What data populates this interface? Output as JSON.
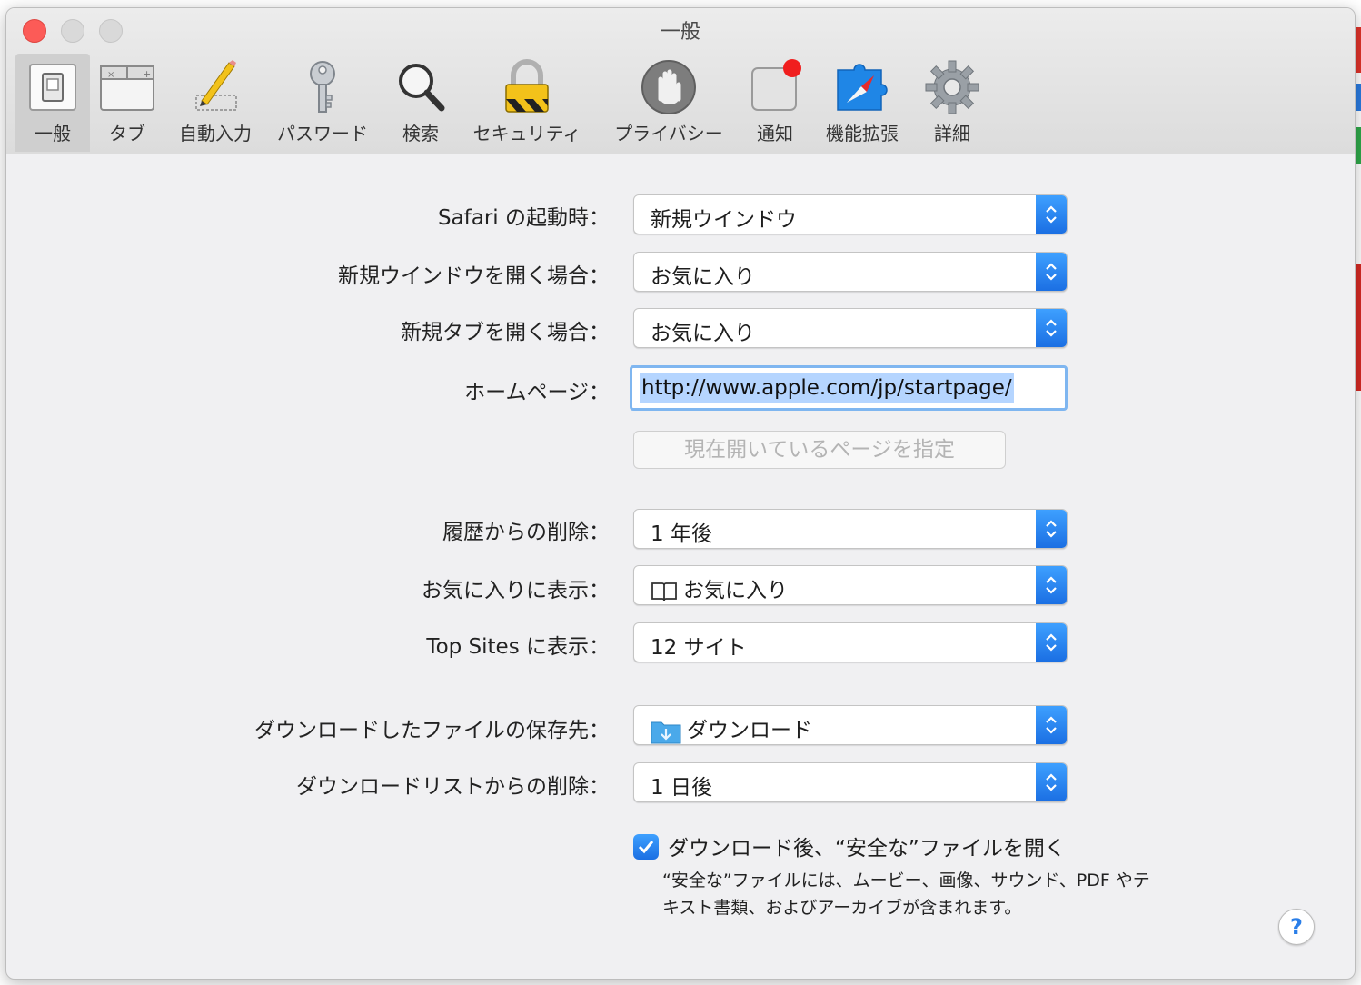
{
  "window": {
    "title": "一般"
  },
  "toolbar": {
    "items": [
      {
        "label": "一般",
        "icon": "general-switch-icon",
        "selected": true
      },
      {
        "label": "タブ",
        "icon": "tabs-icon"
      },
      {
        "label": "自動入力",
        "icon": "pencil-icon"
      },
      {
        "label": "パスワード",
        "icon": "key-icon"
      },
      {
        "label": "検索",
        "icon": "magnifier-icon"
      },
      {
        "label": "セキュリティ",
        "icon": "padlock-icon"
      },
      {
        "label": "プライバシー",
        "icon": "hand-icon"
      },
      {
        "label": "通知",
        "icon": "notification-icon"
      },
      {
        "label": "機能拡張",
        "icon": "extension-compass-icon"
      },
      {
        "label": "詳細",
        "icon": "gear-icon"
      }
    ]
  },
  "settings": {
    "launch": {
      "label": "Safari の起動時：",
      "value": "新規ウインドウ"
    },
    "new_window": {
      "label": "新規ウインドウを開く場合：",
      "value": "お気に入り"
    },
    "new_tab": {
      "label": "新規タブを開く場合：",
      "value": "お気に入り"
    },
    "homepage": {
      "label": "ホームページ：",
      "value": "http://www.apple.com/jp/startpage/"
    },
    "set_current_page_button": "現在開いているページを指定",
    "history_removal": {
      "label": "履歴からの削除：",
      "value": "1 年後"
    },
    "favorites_show": {
      "label": "お気に入りに表示：",
      "value": "お気に入り",
      "icon": "book-icon"
    },
    "top_sites": {
      "label": "Top Sites に表示：",
      "value": "12 サイト"
    },
    "download_location": {
      "label": "ダウンロードしたファイルの保存先：",
      "value": "ダウンロード",
      "icon": "downloads-folder-icon"
    },
    "download_list_removal": {
      "label": "ダウンロードリストからの削除：",
      "value": "1 日後"
    },
    "open_safe_files": {
      "label": "ダウンロード後、“安全な”ファイルを開く",
      "checked": true,
      "note": "“安全な”ファイルには、ムービー、画像、サウンド、PDF やテキスト書類、およびアーカイブが含まれます。"
    },
    "help_button": "?"
  },
  "colors": {
    "accent": "#1b6fe3",
    "close": "#fc5b57",
    "selection": "#b5d5ff"
  }
}
